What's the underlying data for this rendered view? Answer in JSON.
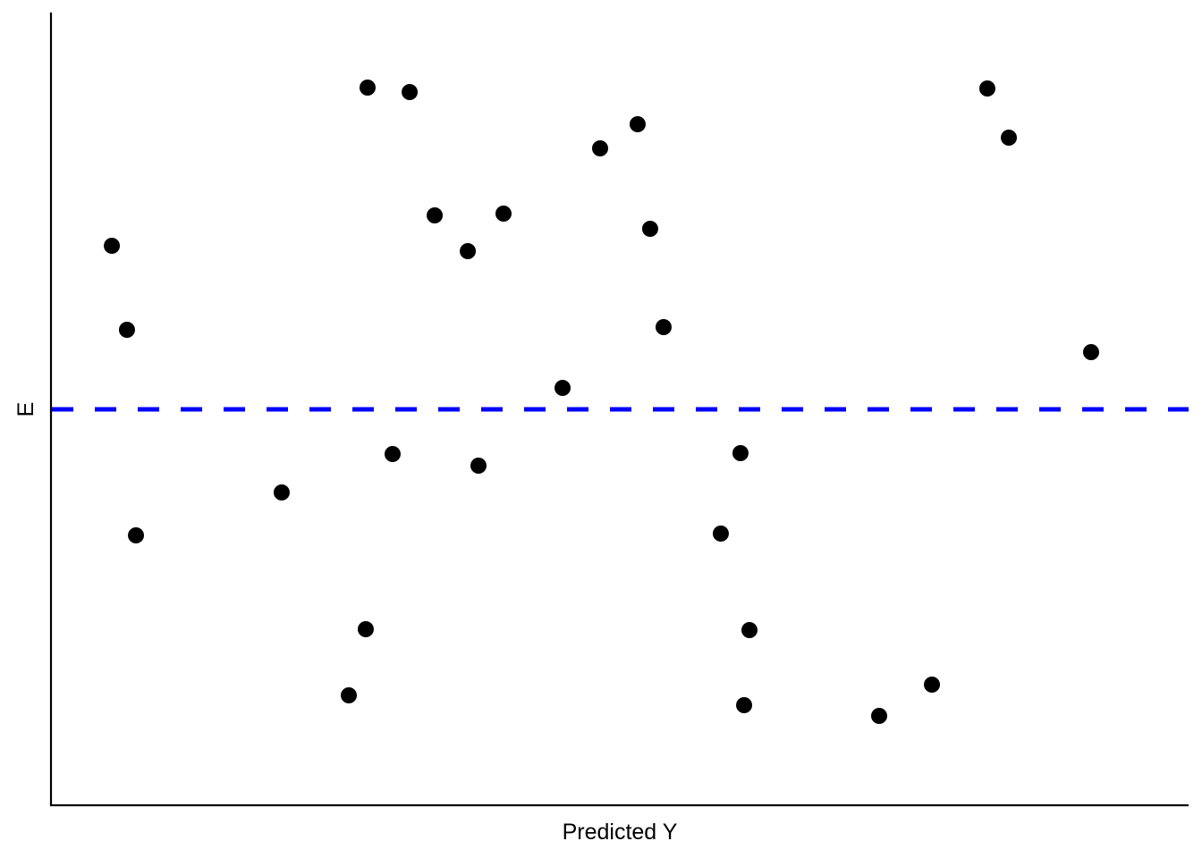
{
  "chart_data": {
    "type": "scatter",
    "title": "",
    "xlabel": "Predicted Y",
    "ylabel": "E",
    "xlim": [
      0,
      100
    ],
    "ylim": [
      -4.43,
      4.44
    ],
    "grid": false,
    "tick_labels_shown": false,
    "reference_line": {
      "y": 0,
      "style": "dashed",
      "color": "#0000ff"
    },
    "point_color": "#000000",
    "points": [
      {
        "x": 5.35,
        "y": 1.83
      },
      {
        "x": 6.68,
        "y": 0.89
      },
      {
        "x": 7.47,
        "y": -1.41
      },
      {
        "x": 20.28,
        "y": -0.93
      },
      {
        "x": 26.18,
        "y": -3.2
      },
      {
        "x": 27.67,
        "y": -2.46
      },
      {
        "x": 27.83,
        "y": 3.6
      },
      {
        "x": 30.03,
        "y": -0.5
      },
      {
        "x": 31.53,
        "y": 3.55
      },
      {
        "x": 33.73,
        "y": 2.17
      },
      {
        "x": 36.64,
        "y": 1.77
      },
      {
        "x": 37.58,
        "y": -0.63
      },
      {
        "x": 39.78,
        "y": 2.19
      },
      {
        "x": 44.97,
        "y": 0.24
      },
      {
        "x": 48.27,
        "y": 2.92
      },
      {
        "x": 51.57,
        "y": 3.19
      },
      {
        "x": 52.67,
        "y": 2.02
      },
      {
        "x": 53.85,
        "y": 0.92
      },
      {
        "x": 58.88,
        "y": -1.39
      },
      {
        "x": 60.61,
        "y": -0.49
      },
      {
        "x": 60.93,
        "y": -3.31
      },
      {
        "x": 61.4,
        "y": -2.47
      },
      {
        "x": 72.8,
        "y": -3.43
      },
      {
        "x": 77.44,
        "y": -3.08
      },
      {
        "x": 82.31,
        "y": 3.59
      },
      {
        "x": 84.2,
        "y": 3.04
      },
      {
        "x": 91.43,
        "y": 0.64
      }
    ]
  }
}
